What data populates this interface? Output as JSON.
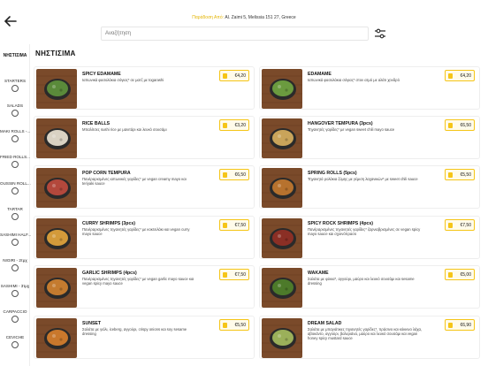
{
  "header": {
    "address_highlight": "Παράδοση Από:",
    "address_text": " Al. Zaimi 5, Melissia 151 27, Greece",
    "search_placeholder": "Αναζήτηση"
  },
  "sidebar": {
    "items": [
      {
        "label": "ΝΗΣΤΙΣΙΜΑ",
        "active": true
      },
      {
        "label": "STARTERS"
      },
      {
        "label": "SALADS"
      },
      {
        "label": "MAKI ROLLS -..."
      },
      {
        "label": "FRIED ROLLS..."
      },
      {
        "label": "OUSSIN ROLL..."
      },
      {
        "label": "TARTAR"
      },
      {
        "label": "SASHIMI HALF..."
      },
      {
        "label": "NIGIRI - 2τμχ"
      },
      {
        "label": "SASHIMI - 3τμχ"
      },
      {
        "label": "CARPACCIO"
      },
      {
        "label": "CEVICHE"
      }
    ]
  },
  "section_title": "ΝΗΣΤΙΣΙΜΑ",
  "products": [
    {
      "name": "SPICY EDAMAME",
      "desc": "Ιαπωνικά φασολάκια σόγιας* σε ματζ με togarashi",
      "price": "€4,20",
      "food": "#5a8a3a"
    },
    {
      "name": "EDAMAME",
      "desc": "Ιαπωνικά φασολάκια σόγιας* στον ατμό με αλάτι χονδρό",
      "price": "€4,20",
      "food": "#6b9b3f"
    },
    {
      "name": "RICE BALLS",
      "desc": "Μπαλίτσες sushi rice με μανιτάρι και λευκό σουσάμι",
      "price": "€3,20",
      "food": "#d9d2c3"
    },
    {
      "name": "HANGOVER TEMPURA (3pcs)",
      "desc": "Τηγανητές γαρίδες* με vegan sweet chili mayo sauce",
      "price": "€6,50",
      "food": "#c9a45a"
    },
    {
      "name": "POP CORN TEMPURA",
      "desc": "Πανέραρισμένες ιαπωνικές γαρίδες* με vegan creamy mayo και teriyaki sauce",
      "price": "€6,50",
      "food": "#b3483c"
    },
    {
      "name": "SPRING ROLLS (5pcs)",
      "desc": "Τηγανητά ρολάκια ζύμης με γέμιση λαχανικών* με sweet chili sauce",
      "price": "€5,50",
      "food": "#b7722e"
    },
    {
      "name": "CURRY SHRIMPS (3pcs)",
      "desc": "Πανέραρισμένες τηγανητές γαρίδες* με κοκτειλάκι και vegan curry mayo sauce",
      "price": "€7,50",
      "food": "#d39a3a"
    },
    {
      "name": "SPICY ROCK SHRIMPS (4pcs)",
      "desc": "Πανέραρισμένες τηγανητές γαρίδες* ζαρνιαβρισμένες σε vegan spicy mayo sauce και σχοινόπρασο",
      "price": "€7,50",
      "food": "#8b2f25"
    },
    {
      "name": "GARLIC SHRIMPS (4pcs)",
      "desc": "Πανέραρισμένες τηγανητές γαρίδες* με vegan garlic mayo sauce και vegan spicy mayo sauce",
      "price": "€7,50",
      "food": "#c47b2f"
    },
    {
      "name": "WAKAME",
      "desc": "Σαλάτα με φύκια*, αγγούρι, μαύρο και λευκό σουσάμι και sesame dressing",
      "price": "€5,00",
      "food": "#4d7a2a"
    },
    {
      "name": "SUNSET",
      "desc": "Σαλάτα με γιόλι, iceberg, αγγούρι, crispy onions και soy sesame dressing",
      "price": "€5,50",
      "food": "#c9782c"
    },
    {
      "name": "DREAM SALAD",
      "desc": "Σαλάτα με μπαγιάτικες τηγανητές γαρίδες*, πράσινο και κόκκινο λάχα, αβοκάντο, αγγούρι, βαλεριάνα, μαύρο και λευκό σουσάμι και vegan honey spicy mustard sauce",
      "price": "€6,90",
      "food": "#9bb05a"
    }
  ],
  "colors": {
    "accent": "#f5c518",
    "wood": "#7a4a2a"
  }
}
